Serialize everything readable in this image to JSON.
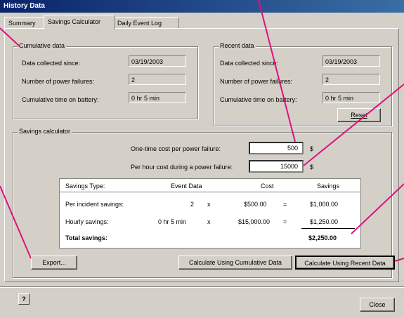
{
  "window": {
    "title": "History Data"
  },
  "tabs": [
    {
      "label": "Summary"
    },
    {
      "label": "Savings Calculator"
    },
    {
      "label": "Daily Event Log"
    }
  ],
  "cumulative": {
    "title": "Cumulative data",
    "since_label": "Data collected since:",
    "since_value": "03/19/2003",
    "failures_label": "Number of power failures:",
    "failures_value": "2",
    "battery_label": "Cumulative time on battery:",
    "battery_value": "0 hr 5 min"
  },
  "recent": {
    "title": "Recent data",
    "since_label": "Data collected since:",
    "since_value": "03/19/2003",
    "failures_label": "Number of power failures:",
    "failures_value": "2",
    "battery_label": "Cumulative time on battery:",
    "battery_value": "0 hr 5 min",
    "reset_label": "Reset"
  },
  "calculator": {
    "title": "Savings calculator",
    "onetime_label": "One-time cost per power failure:",
    "onetime_value": "500",
    "perhour_label": "Per hour cost during a power failure:",
    "perhour_value": "15000",
    "currency": "$"
  },
  "savings_table": {
    "headers": [
      "Savings Type:",
      "Event Data",
      "Cost",
      "Savings"
    ],
    "rows": [
      {
        "type": "Per incident savings:",
        "event": "2",
        "op": "x",
        "cost": "$500.00",
        "eq": "=",
        "savings": "$1,000.00"
      },
      {
        "type": "Hourly savings:",
        "event": "0 hr 5 min",
        "op": "x",
        "cost": "$15,000.00",
        "eq": "=",
        "savings": "$1,250.00"
      }
    ],
    "total_label": "Total savings:",
    "total_value": "$2,250.00"
  },
  "buttons": {
    "export": "Export...",
    "calc_cumulative": "Calculate Using Cumulative Data",
    "calc_recent": "Calculate Using Recent Data",
    "close": "Close"
  },
  "icons": {
    "help": "help-icon"
  },
  "colors": {
    "callout": "#e0107a",
    "title_bar": "#0a246a",
    "window_bg": "#d4d0c8"
  }
}
